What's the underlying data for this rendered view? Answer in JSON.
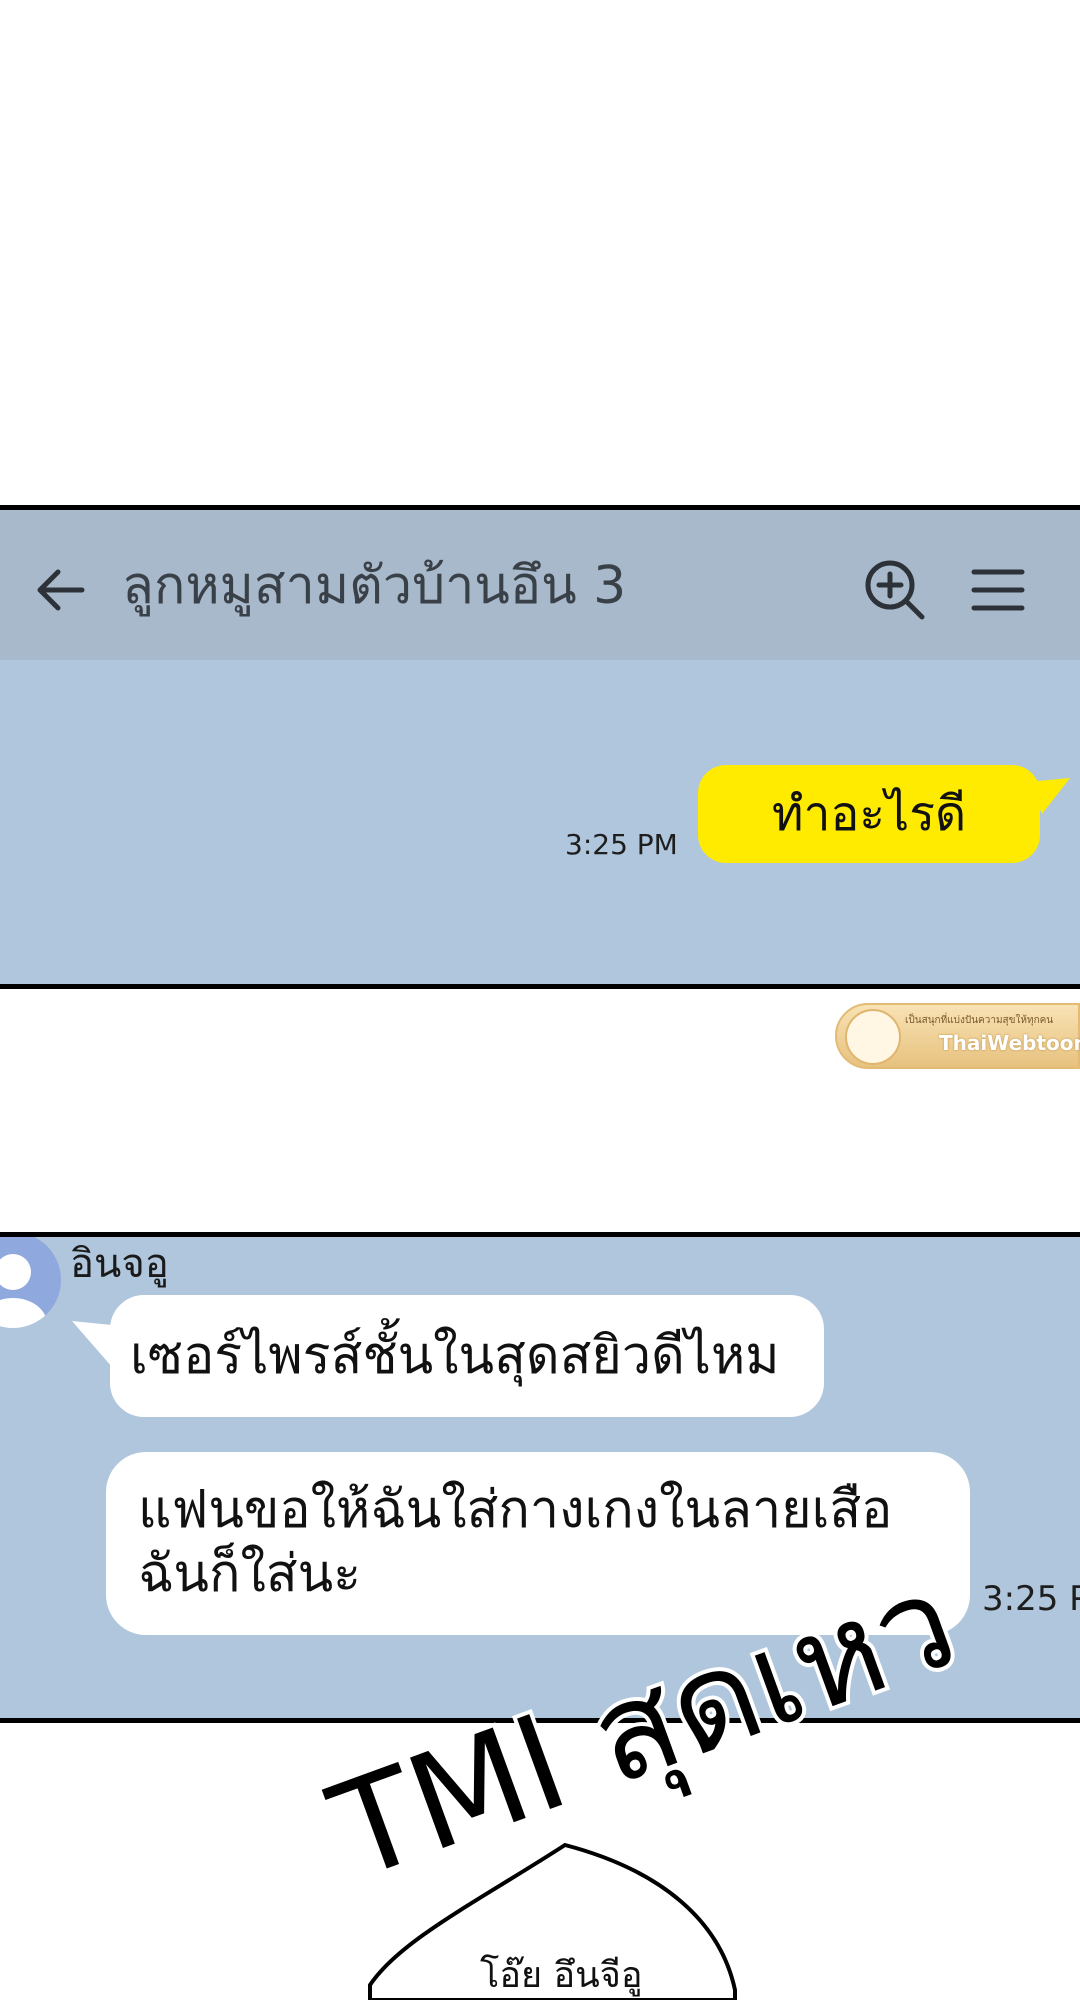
{
  "panel1": {
    "header": {
      "title": "ลูกหมูสามตัวบ้านอึน 3",
      "back_icon": "arrow-left-icon",
      "zoom_icon": "zoom-in-icon",
      "menu_icon": "hamburger-menu-icon"
    },
    "message": {
      "text": "ทำอะไรดี",
      "time": "3:25 PM",
      "bubble_color": "#ffeb00"
    },
    "background": "#afc6dc"
  },
  "watermark": {
    "tagline": "เป็นสนุกที่แบ่งปันความสุขให้ทุกคน",
    "brand": "ThaiWebtoon"
  },
  "panel2": {
    "sender": "อินจอู",
    "messages": [
      {
        "text": "เซอร์ไพรส์ชั้นในสุดสยิวดีไหม"
      },
      {
        "lines": [
          "แฟนขอให้ฉันใส่กางเกงในลายเสือ",
          "ฉันก็ใส่นะ"
        ]
      }
    ],
    "time": "3:25 P"
  },
  "sfx": {
    "text": "TMI สุดเหว"
  },
  "speech": {
    "text": "โอ๊ย อึนจีอู"
  }
}
